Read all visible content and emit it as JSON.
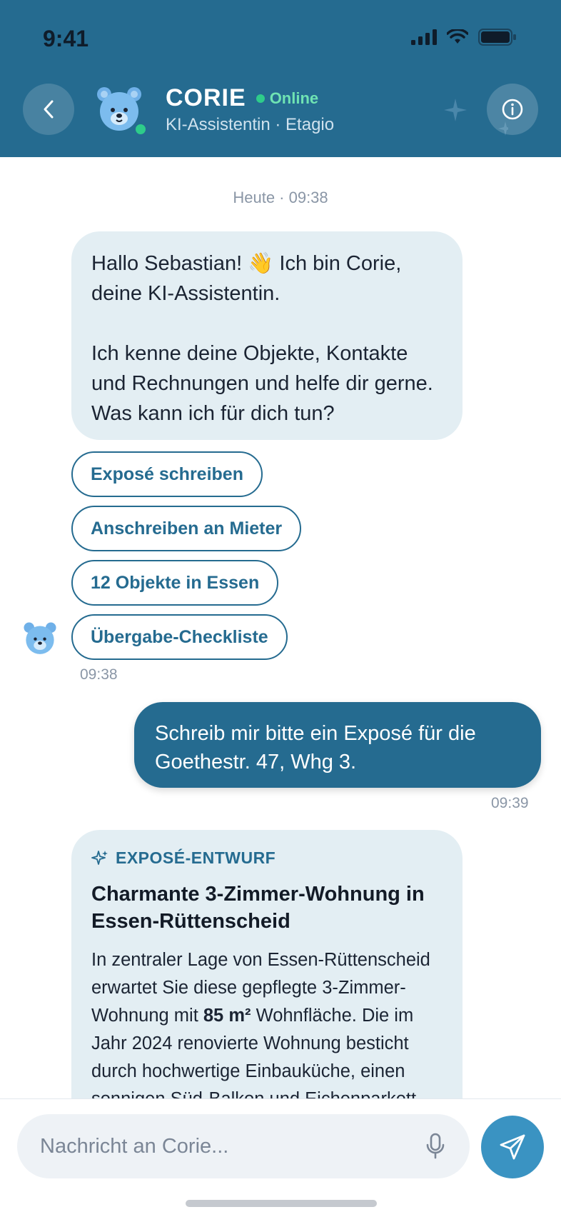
{
  "status_bar": {
    "time": "9:41"
  },
  "header": {
    "title": "CORIE",
    "presence": "Online",
    "subtitle": "KI-Assistentin · Etagio"
  },
  "chat": {
    "date_separator": "Heute · 09:38",
    "bot_message": {
      "line1": "Hallo Sebastian! 👋 Ich bin Corie, deine KI-Assistentin.",
      "line2": "Ich kenne deine Objekte, Kontakte und Rechnungen und helfe dir gerne. Was kann ich für dich tun?",
      "time": "09:38"
    },
    "quick_replies": [
      "Exposé schreiben",
      "Anschreiben an Mieter",
      "12 Objekte in Essen",
      "Übergabe-Checkliste"
    ],
    "user_message": {
      "text": "Schreib mir bitte ein Exposé für die Goethestr. 47, Whg 3.",
      "time": "09:39"
    },
    "expose_card": {
      "tag": "EXPOSÉ-ENTWURF",
      "title": "Charmante 3-Zimmer-Wohnung in Essen-Rüttenscheid",
      "body_before": "In zentraler Lage von Essen-Rüttenscheid erwartet Sie diese gepflegte 3-Zimmer-Wohnung mit ",
      "body_bold": "85 m²",
      "body_after": " Wohnfläche. Die im Jahr 2024 renovierte Wohnung besticht durch hochwertige Einbauküche, einen sonnigen Süd-Balkon und Eichenparkett"
    }
  },
  "composer": {
    "placeholder": "Nachricht an Corie..."
  },
  "colors": {
    "header": "#256b90",
    "accent": "#3a93c2",
    "online": "#2ecc8a",
    "bot_bubble": "#e3eef3"
  }
}
